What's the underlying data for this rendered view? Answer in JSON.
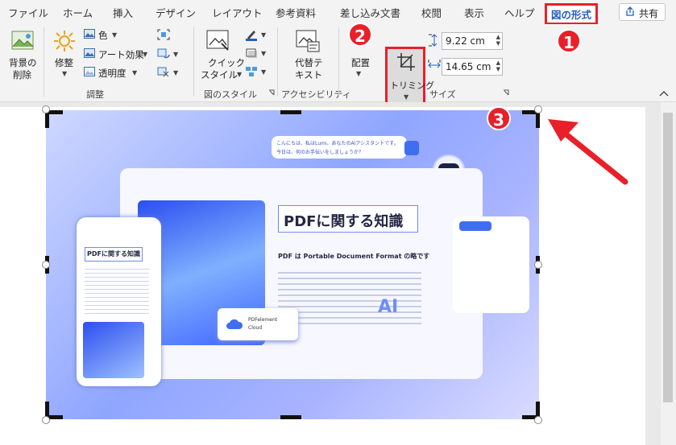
{
  "tabs": [
    "ファイル",
    "ホーム",
    "挿入",
    "デザイン",
    "レイアウト",
    "参考資料",
    "差し込み文書",
    "校閲",
    "表示",
    "ヘルプ",
    "図の形式"
  ],
  "share_label": "共有",
  "ribbon": {
    "remove_bg_line1": "背景の",
    "remove_bg_line2": "削除",
    "corrections": "修整",
    "color": "色",
    "art_effects": "アート効果",
    "transparency": "透明度",
    "adjust_group": "調整",
    "quick_styles_line1": "クイック",
    "quick_styles_line2": "スタイル",
    "styles_group": "図のスタイル",
    "alt_text_line1": "代替テ",
    "alt_text_line2": "キスト",
    "accessibility_group": "アクセシビリティ",
    "position": "配置",
    "crop": "トリミング",
    "height": "9.22 cm",
    "width": "14.65 cm",
    "size_group": "サイズ"
  },
  "badges": [
    "1",
    "2",
    "3"
  ],
  "image_content": {
    "assistant_line1": "こんにちは、私はLumi、あなたのAIアシスタントです。",
    "assistant_line2": "今日は、何のお手伝いをしましょうか？",
    "heading": "PDFに関する知識",
    "subheading": "PDF は Portable Document Format の略です",
    "phone_heading": "PDFに関する知識",
    "cloud_line1": "PDFelement",
    "cloud_line2": "Cloud",
    "ai": "AI"
  },
  "colors": {
    "accent": "#e8202a",
    "active_tab": "#1f5fbf"
  }
}
